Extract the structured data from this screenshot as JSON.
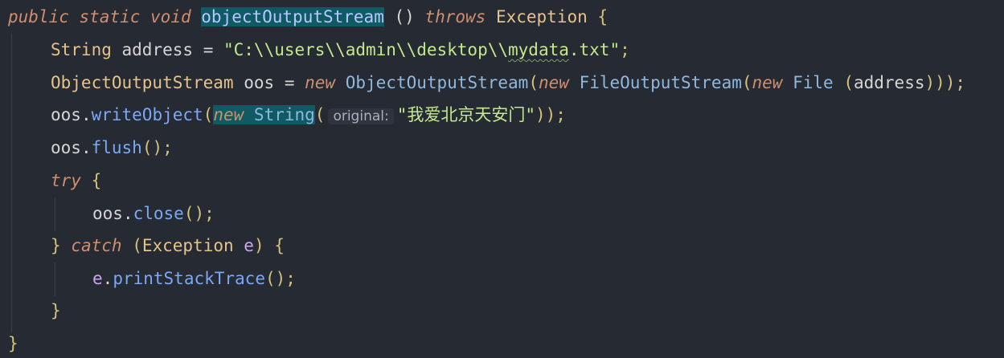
{
  "colors": {
    "background": "#262a33",
    "keyword": "#cf8e6d",
    "string": "#c3e88d",
    "method": "#7aa8f5",
    "highlight": "#0f5a63"
  },
  "code": {
    "l1": {
      "public": "public",
      "static": "static",
      "void": "void",
      "name": "objectOutputStream",
      "parens": "()",
      "throws": "throws",
      "exception": "Exception",
      "brace": "{"
    },
    "l2": {
      "type": "String",
      "var": "address",
      "eq": "=",
      "str_a": "\"C:\\\\users\\\\admin\\\\desktop\\\\",
      "str_b": "mydata",
      "str_c": ".txt\"",
      "semi": ";"
    },
    "l3": {
      "type": "ObjectOutputStream",
      "var": "oos",
      "eq": "=",
      "new1": "new",
      "cls1": "ObjectOutputStream",
      "open1": "(",
      "new2": "new",
      "cls2": "FileOutputStream",
      "open2": "(",
      "new3": "new",
      "cls3": "File",
      "open3": " (",
      "arg": "address",
      "close": ")));"
    },
    "l4": {
      "obj": "oos",
      "dot": ".",
      "method": "writeObject",
      "open": "(",
      "new": "new",
      "cls": "String",
      "open2": "(",
      "hint": "original:",
      "str": "\"我爱北京天安门\"",
      "close": "));"
    },
    "l5": {
      "obj": "oos",
      "dot": ".",
      "method": "flush",
      "rest": "();"
    },
    "l6": {
      "try": "try",
      "brace": "{"
    },
    "l7": {
      "obj": "oos",
      "dot": ".",
      "method": "close",
      "rest": "();"
    },
    "l8": {
      "close": "}",
      "catch": "catch",
      "open": "(",
      "exception": "Exception",
      "param": "e",
      "close2": ")",
      "brace": "{"
    },
    "l9": {
      "obj": "e",
      "dot": ".",
      "method": "printStackTrace",
      "rest": "();"
    },
    "l10": {
      "brace": "}"
    },
    "l11": {
      "brace": "}"
    }
  }
}
